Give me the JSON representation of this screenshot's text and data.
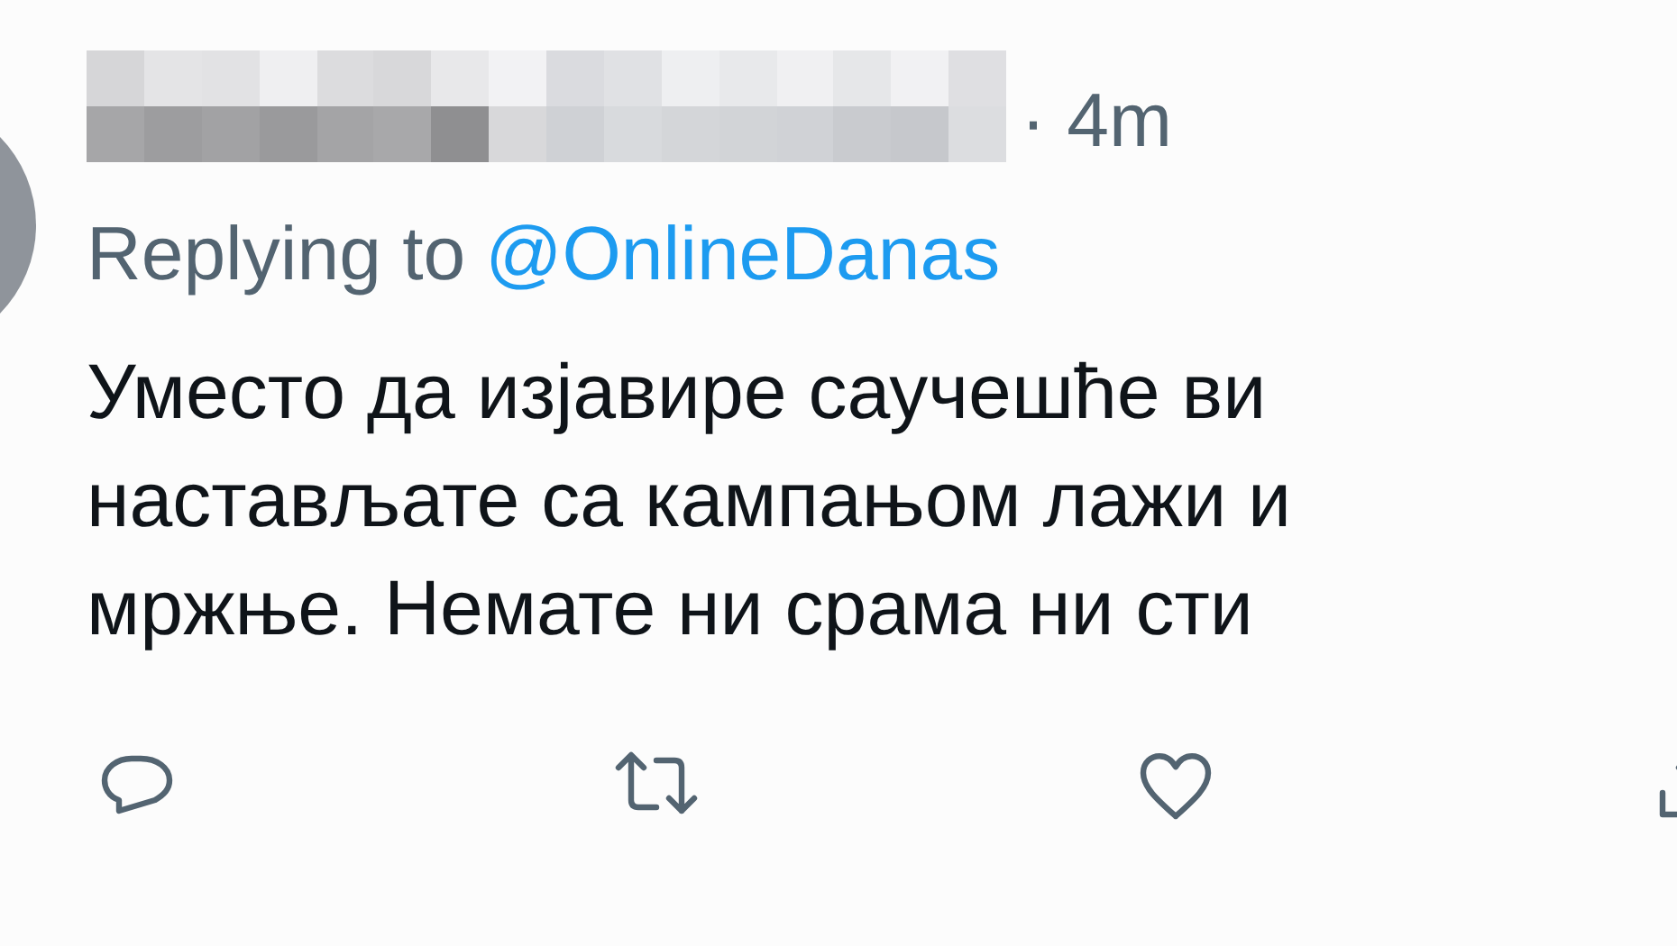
{
  "tweet": {
    "time": "· 4m",
    "replying_prefix": "Replying to",
    "replying_handle": "@OnlineDanas",
    "text_lines": [
      "Уместо да изјавире саучешће ви",
      "настављате са кампањом лажи и",
      "мржње. Немате ни срама ни сти"
    ]
  }
}
